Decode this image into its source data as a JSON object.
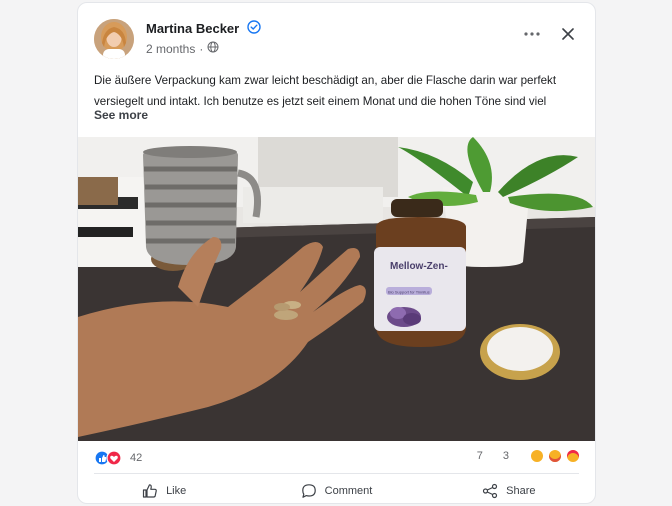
{
  "post": {
    "author_name": "Martina Becker",
    "time_ago": "2 months",
    "meta_separator": "·",
    "body_text": "Die äußere Verpackung kam zwar leicht beschädigt an, aber die Flasche darin war perfekt versiegelt und intakt. Ich benutze es jetzt seit einem Monat und die hohen Töne sind viel",
    "see_more_label": "See more"
  },
  "photo": {
    "bottle_brand": "Mellow-Zen-",
    "bottle_tag": "Bio Support for Tinnitus"
  },
  "stats": {
    "reaction_count": "42",
    "comment_count": "7",
    "share_count": "3"
  },
  "actions": {
    "like_label": "Like",
    "comment_label": "Comment",
    "share_label": "Share"
  },
  "colors": {
    "verified_blue": "#1877f2",
    "like_blue": "#1877f2",
    "heart_red": "#f02849",
    "laugh_yellow": "#f7b125"
  }
}
